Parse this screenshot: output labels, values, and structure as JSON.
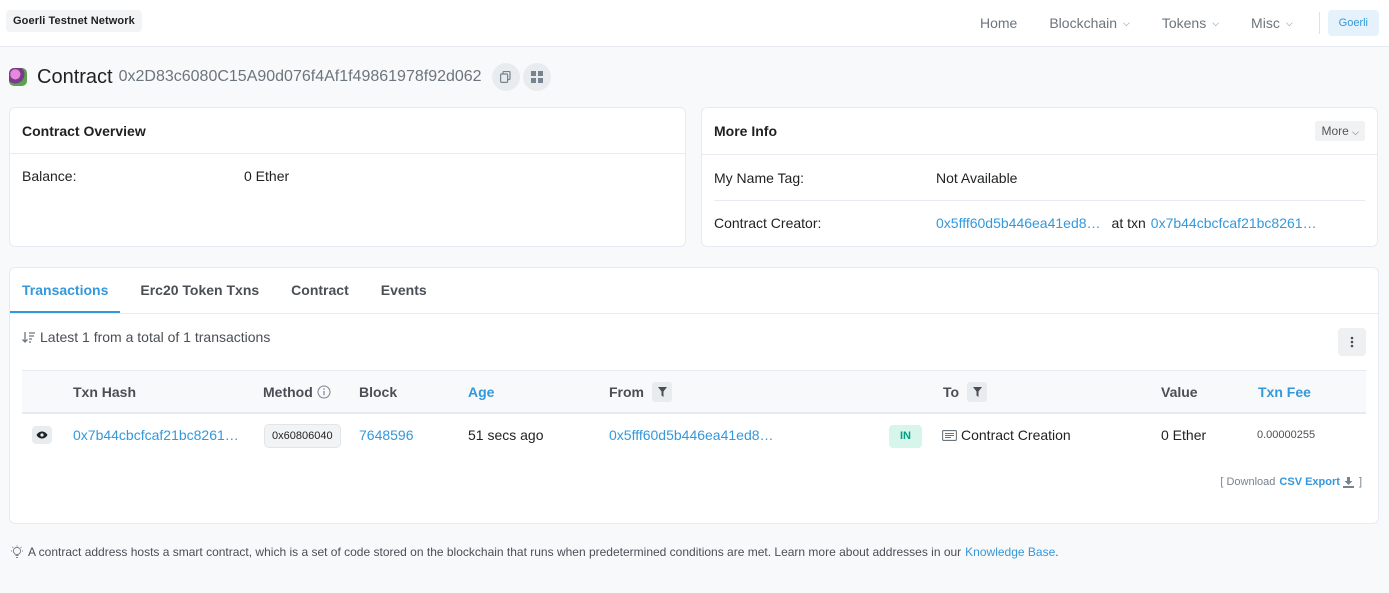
{
  "header": {
    "network_badge": "Goerli Testnet Network",
    "nav": [
      {
        "label": "Home",
        "dropdown": false
      },
      {
        "label": "Blockchain",
        "dropdown": true
      },
      {
        "label": "Tokens",
        "dropdown": true
      },
      {
        "label": "Misc",
        "dropdown": true
      }
    ],
    "network_button": "Goerli"
  },
  "title": {
    "label": "Contract",
    "address": "0x2D83c6080C15A90d076f4Af1f49861978f92d062",
    "icons": [
      "copy-icon",
      "qr-code-icon"
    ]
  },
  "overview": {
    "title": "Contract Overview",
    "balance_label": "Balance:",
    "balance_value": "0 Ether"
  },
  "more_info": {
    "title": "More Info",
    "more_button": "More",
    "name_tag_label": "My Name Tag:",
    "name_tag_value": "Not Available",
    "creator_label": "Contract Creator:",
    "creator_address": "0x5fff60d5b446ea41ed8…",
    "at_txn": "at txn",
    "creator_txn": "0x7b44cbcfcaf21bc8261…"
  },
  "tabs": [
    "Transactions",
    "Erc20 Token Txns",
    "Contract",
    "Events"
  ],
  "summary": "Latest 1 from a total of 1 transactions",
  "table": {
    "headers": {
      "txn_hash": "Txn Hash",
      "method": "Method",
      "block": "Block",
      "age": "Age",
      "from": "From",
      "to": "To",
      "value": "Value",
      "txn_fee": "Txn Fee"
    },
    "rows": [
      {
        "txn_hash": "0x7b44cbcfcaf21bc8261…",
        "method": "0x60806040",
        "block": "7648596",
        "age": "51 secs ago",
        "from": "0x5fff60d5b446ea41ed8…",
        "direction": "IN",
        "to": "Contract Creation",
        "value": "0 Ether",
        "txn_fee": "0.00000255"
      }
    ]
  },
  "download": {
    "prefix": "[ Download",
    "link": "CSV Export",
    "suffix": "]"
  },
  "footer": {
    "text": "A contract address hosts a smart contract, which is a set of code stored on the blockchain that runs when predetermined conditions are met. Learn more about addresses in our",
    "link": "Knowledge Base",
    "end": "."
  },
  "colors": {
    "link": "#3498db",
    "in_badge_bg": "#d7f5ea",
    "in_badge_text": "#00a186"
  }
}
